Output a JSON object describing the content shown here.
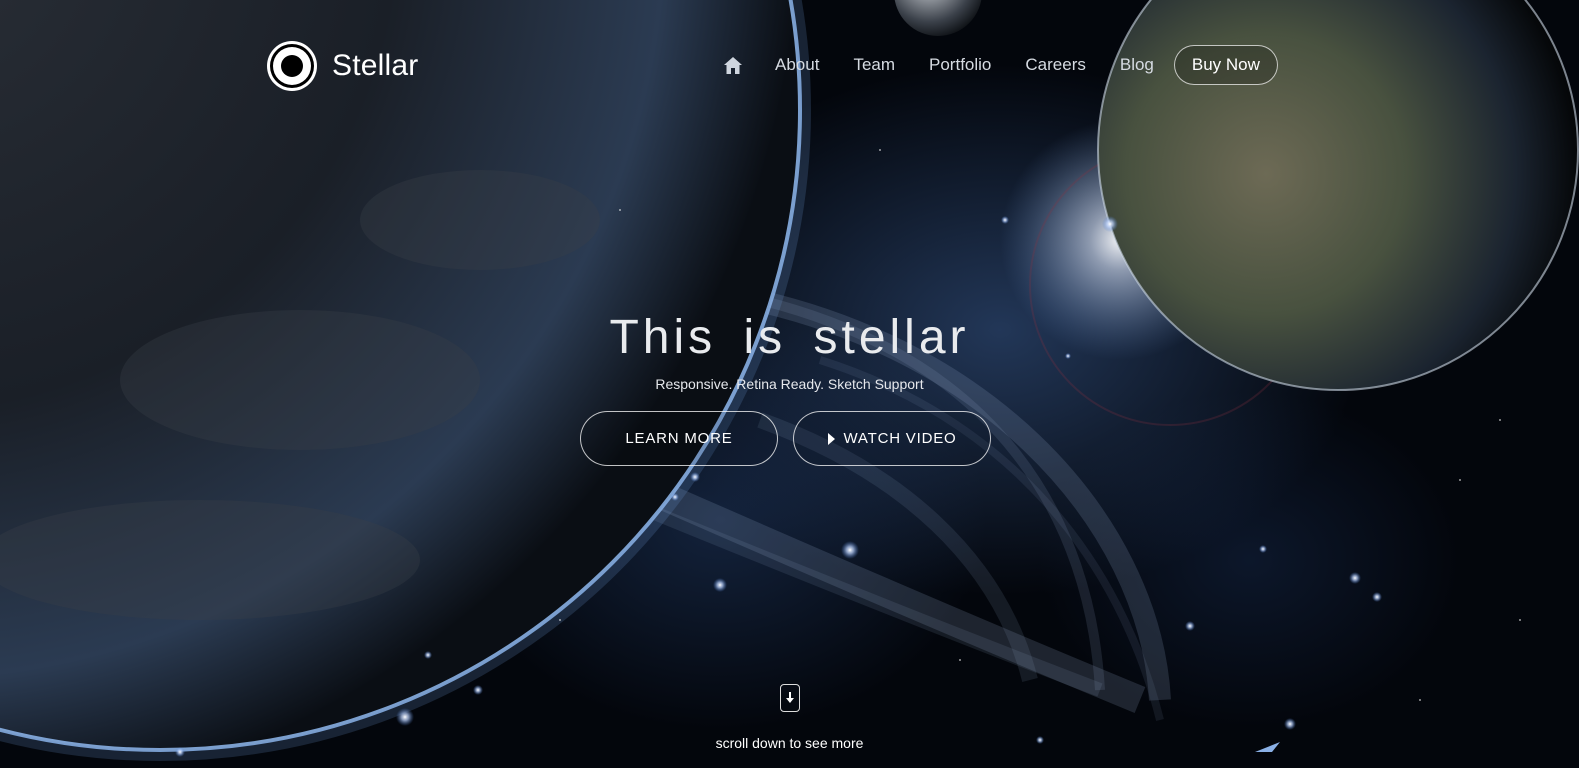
{
  "brand": {
    "name": "Stellar"
  },
  "nav": {
    "home_icon": "home-icon",
    "items": [
      {
        "label": "About"
      },
      {
        "label": "Team"
      },
      {
        "label": "Portfolio"
      },
      {
        "label": "Careers"
      },
      {
        "label": "Blog"
      }
    ],
    "cta": "Buy Now"
  },
  "hero": {
    "title": "This is stellar",
    "subtitle": "Responsive. Retina Ready. Sketch Support",
    "buttons": {
      "learn_more": "LEARN MORE",
      "watch_video": "WATCH VIDEO"
    },
    "scroll_text": "scroll down to see more"
  },
  "colors": {
    "background": "#03060c",
    "text": "#ffffff",
    "nav_text": "#d6dbe2",
    "planet_rim": "#8fb8ee"
  },
  "icons": {
    "play": "play-icon",
    "scroll": "arrow-down-icon"
  }
}
